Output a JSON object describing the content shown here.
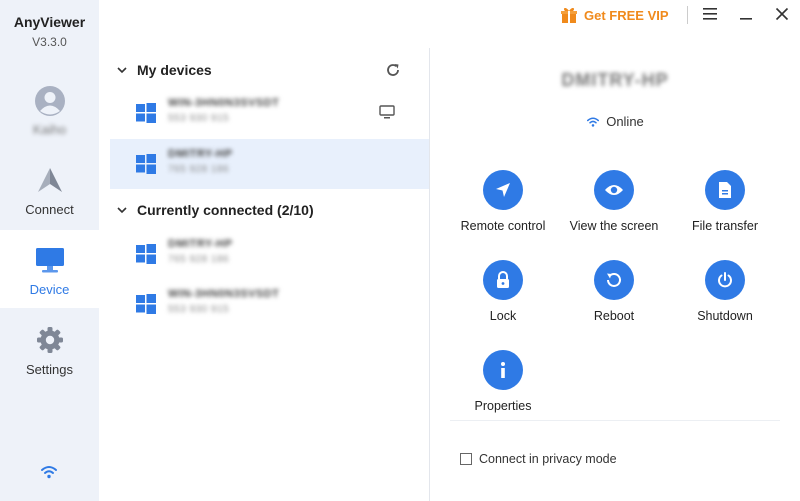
{
  "app": {
    "name": "AnyViewer",
    "version": "V3.3.0"
  },
  "sidebar": {
    "user_name": "Kaiho",
    "items": [
      {
        "label": "Connect"
      },
      {
        "label": "Device"
      },
      {
        "label": "Settings"
      }
    ]
  },
  "topbar": {
    "vip_label": "Get FREE VIP"
  },
  "device_list": {
    "my_devices": {
      "title": "My devices",
      "devices": [
        {
          "name": "WIN-3HN0N3SVSDT",
          "id": "553 930 915"
        },
        {
          "name": "DMITRY-HP",
          "id": "765 928 186"
        }
      ]
    },
    "connected": {
      "title": "Currently connected (2/10)",
      "devices": [
        {
          "name": "DMITRY-HP",
          "id": "765 928 186"
        },
        {
          "name": "WIN-3HN0N3SVSDT",
          "id": "553 930 915"
        }
      ]
    }
  },
  "detail": {
    "device_name": "DMITRY-HP",
    "status": "Online",
    "actions": [
      {
        "label": "Remote control",
        "icon": "send-icon"
      },
      {
        "label": "View the screen",
        "icon": "eye-icon"
      },
      {
        "label": "File transfer",
        "icon": "file-icon"
      },
      {
        "label": "Lock",
        "icon": "lock-icon"
      },
      {
        "label": "Reboot",
        "icon": "reboot-icon"
      },
      {
        "label": "Shutdown",
        "icon": "power-icon"
      },
      {
        "label": "Properties",
        "icon": "info-icon"
      }
    ],
    "privacy_label": "Connect in privacy mode",
    "privacy_checked": false
  },
  "colors": {
    "accent": "#2f7ae5",
    "sidebar_bg": "#eef2f9",
    "selected_row": "#e8f0fc",
    "vip": "#f08a1c"
  }
}
